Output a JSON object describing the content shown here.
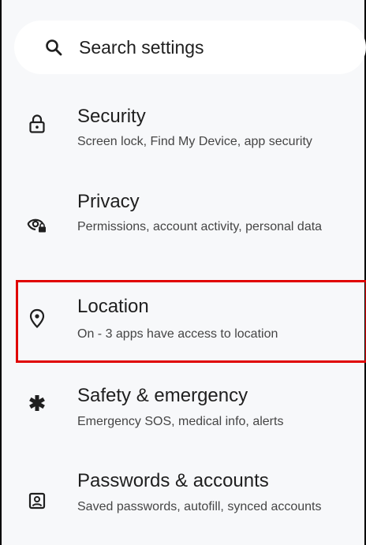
{
  "search": {
    "placeholder": "Search settings",
    "icon": "search-icon"
  },
  "settings": {
    "items": [
      {
        "title": "Security",
        "subtitle": "Screen lock, Find My Device, app security",
        "icon": "lock-icon"
      },
      {
        "title": "Privacy",
        "subtitle": "Permissions, account activity, personal data",
        "icon": "privacy-eye-lock-icon"
      },
      {
        "title": "Location",
        "subtitle": "On - 3 apps have access to location",
        "icon": "location-pin-icon",
        "highlighted": true
      },
      {
        "title": "Safety & emergency",
        "subtitle": "Emergency SOS, medical info, alerts",
        "icon": "asterisk-icon"
      },
      {
        "title": "Passwords & accounts",
        "subtitle": "Saved passwords, autofill, synced accounts",
        "icon": "account-box-icon"
      }
    ]
  },
  "colors": {
    "background": "#f7f8fa",
    "highlight_border": "#e00000",
    "text_primary": "#1f1f1f",
    "text_secondary": "#454545"
  }
}
